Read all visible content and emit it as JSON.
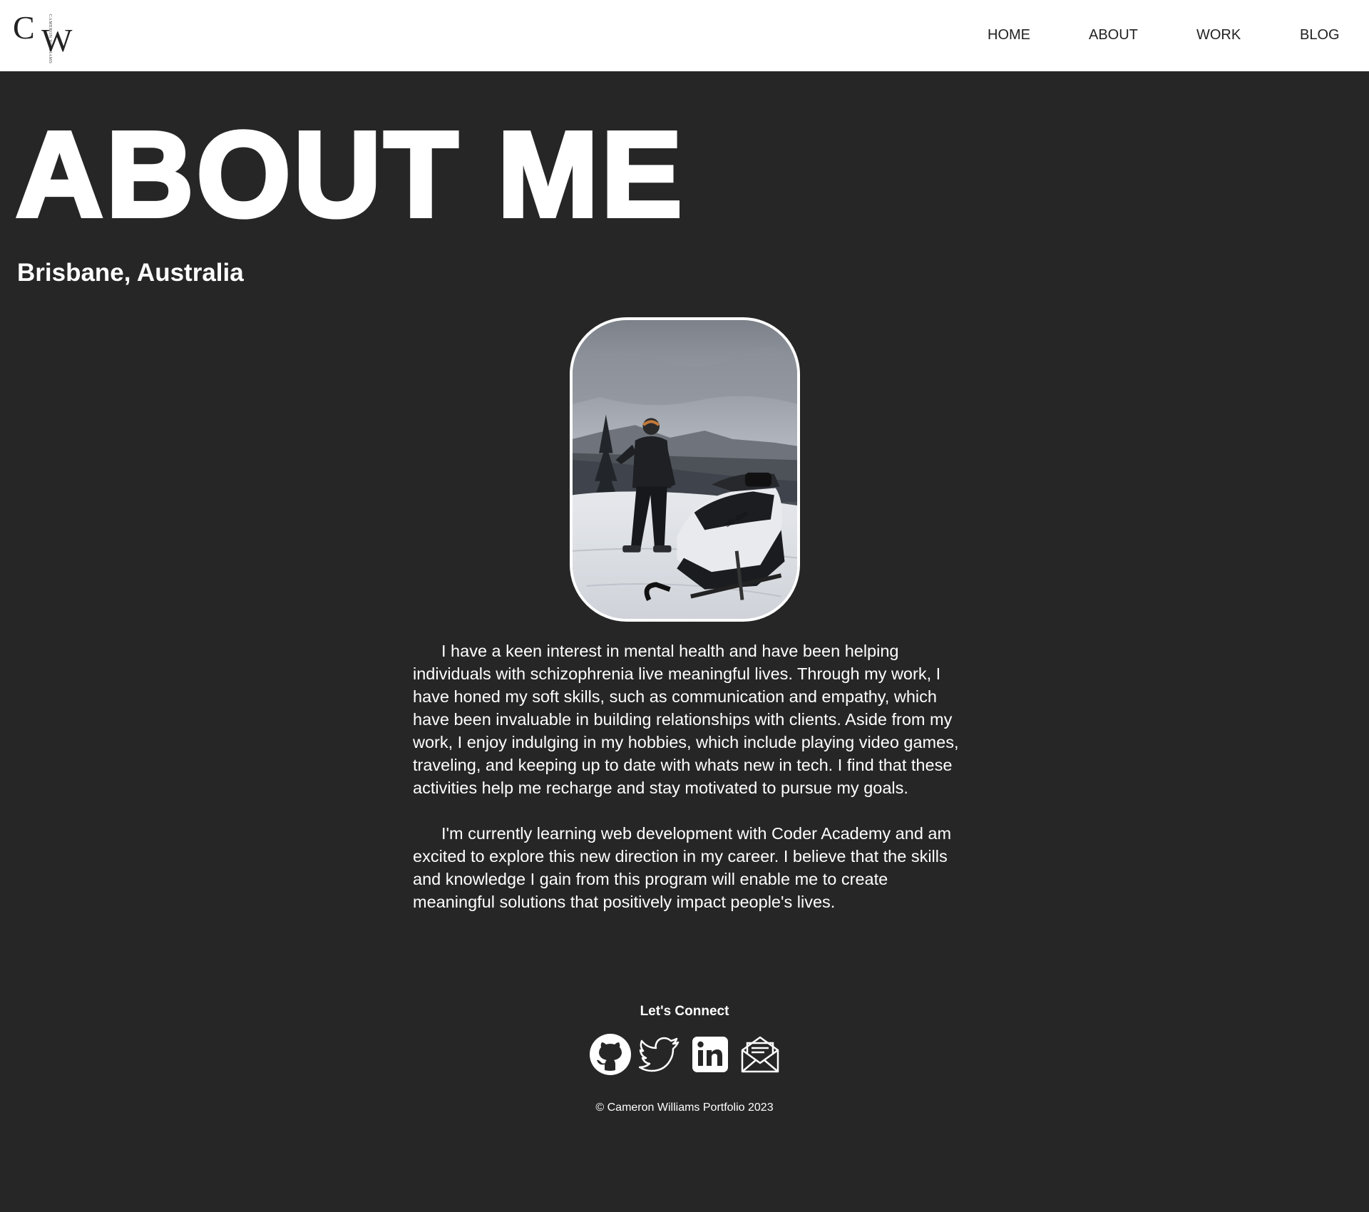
{
  "logo": {
    "initial_c": "C",
    "initial_w": "W",
    "vertical_text": "CAMERON WILLIAMS"
  },
  "nav": {
    "items": [
      {
        "label": "HOME"
      },
      {
        "label": "ABOUT"
      },
      {
        "label": "WORK"
      },
      {
        "label": "BLOG"
      }
    ]
  },
  "hero": {
    "title": "ABOUT ME",
    "location": "Brisbane, Australia"
  },
  "bio": {
    "paragraphs": [
      "I have a keen interest in mental health and have been helping individuals with schizophrenia live meaningful lives. Through my work, I have honed my soft skills, such as communication and empathy, which have been invaluable in building relationships with clients. Aside from my work, I enjoy indulging in my hobbies, which include playing video games, traveling, and keeping up to date with whats new in tech. I find that these activities help me recharge and stay motivated to pursue my goals.",
      "I'm currently learning web development with Coder Academy and am excited to explore this new direction in my career. I believe that the skills and knowledge I gain from this program will enable me to create meaningful solutions that positively impact people's lives."
    ]
  },
  "footer": {
    "connect_title": "Let's Connect",
    "socials": [
      {
        "icon": "github-icon"
      },
      {
        "icon": "twitter-icon"
      },
      {
        "icon": "linkedin-icon"
      },
      {
        "icon": "email-icon"
      }
    ],
    "copyright": "© Cameron Williams Portfolio 2023"
  },
  "colors": {
    "background": "#262626",
    "navbar": "#ffffff",
    "text": "#ffffff",
    "nav_text": "#222222"
  }
}
